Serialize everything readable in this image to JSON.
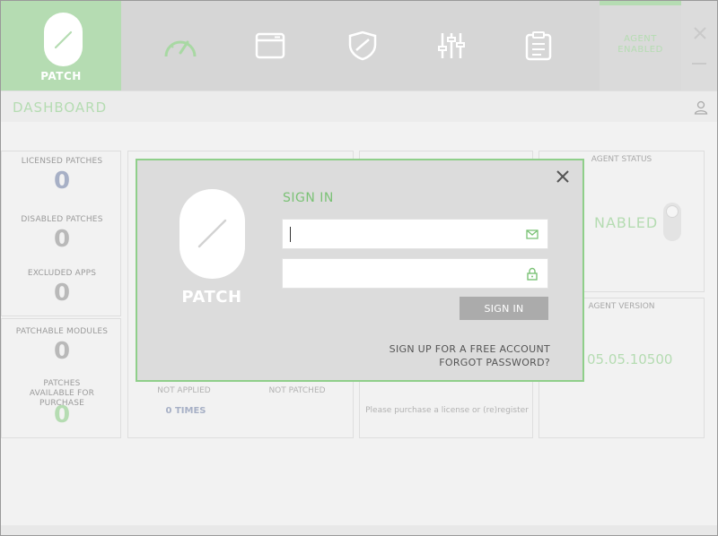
{
  "app": {
    "logo_text": "PATCH",
    "agent_status_lines": [
      "AGENT",
      "ENABLED"
    ]
  },
  "nav": {
    "items": [
      {
        "icon": "speedometer-icon"
      },
      {
        "icon": "browser-window-icon"
      },
      {
        "icon": "shield-icon"
      },
      {
        "icon": "sliders-icon"
      },
      {
        "icon": "clipboard-icon"
      }
    ]
  },
  "dashboard": {
    "title": "DASHBOARD",
    "stats": [
      {
        "label": "LICENSED PATCHES",
        "value": "0"
      },
      {
        "label": "DISABLED PATCHES",
        "value": "0"
      },
      {
        "label": "EXCLUDED APPS",
        "value": "0"
      },
      {
        "label": "PATCHABLE MODULES",
        "value": "0"
      },
      {
        "label": "PATCHES AVAILABLE FOR PURCHASE",
        "value": "0"
      }
    ],
    "not_applied_label": "NOT APPLIED",
    "not_patched_label": "NOT PATCHED",
    "times_value": "0 TIMES",
    "purchase_note": "Please purchase a license or (re)register",
    "agent_status_label": "AGENT STATUS",
    "agent_status_value": "NABLED",
    "agent_version_label": "AGENT VERSION",
    "agent_version_value": "05.05.10500"
  },
  "modal": {
    "logo_text": "PATCH",
    "title": "SIGN IN",
    "email_value": "",
    "password_value": "",
    "signin_button": "SIGN IN",
    "signup_link": "SIGN UP FOR A FREE ACCOUNT",
    "forgot_link": "FORGOT PASSWORD?"
  },
  "colors": {
    "accent_green": "#b5dcb2",
    "modal_border": "#8fcf8a"
  }
}
